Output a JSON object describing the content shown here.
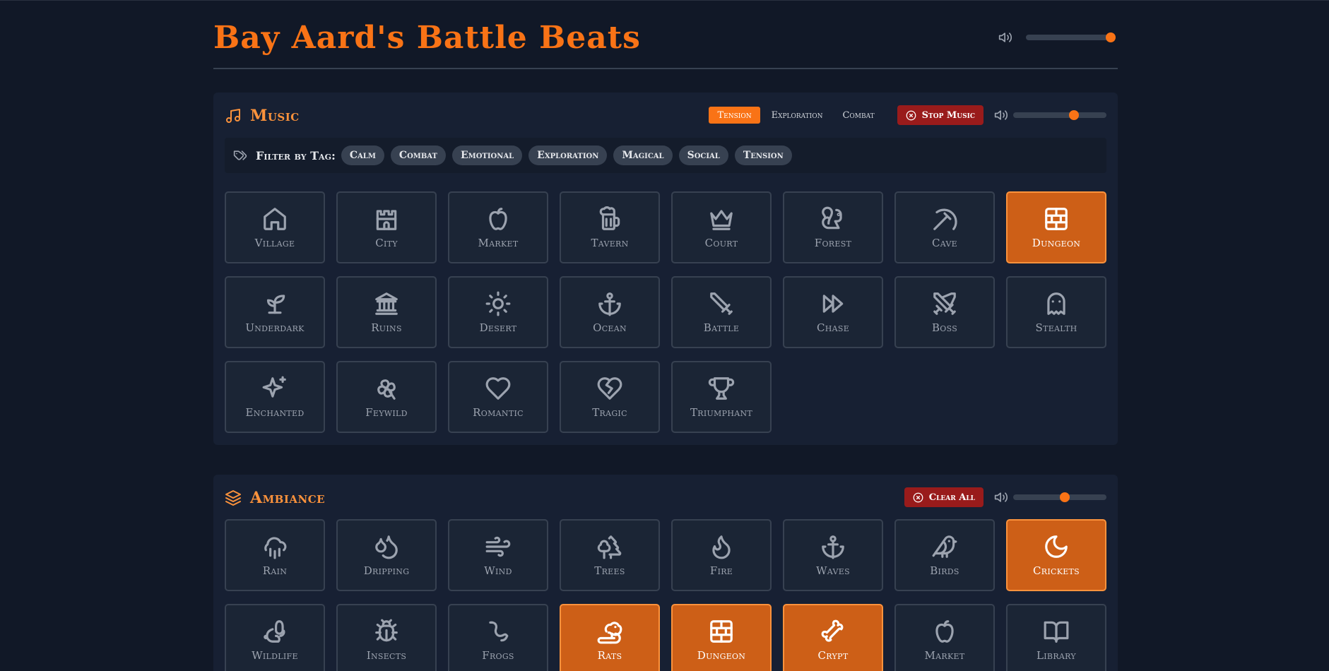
{
  "app": {
    "title": "Bay Aard's Battle Beats",
    "master_volume": 0.95
  },
  "colors": {
    "accent": "#f97316",
    "danger": "#991b1b",
    "background": "#111827"
  },
  "music": {
    "title": "Music",
    "icon": "music-note-icon",
    "modes": [
      {
        "label": "Tension",
        "active": true
      },
      {
        "label": "Exploration",
        "active": false
      },
      {
        "label": "Combat",
        "active": false
      }
    ],
    "stop_label": "Stop Music",
    "volume": 0.65,
    "filter_label": "Filter by Tag:",
    "tags": [
      "Calm",
      "Combat",
      "Emotional",
      "Exploration",
      "Magical",
      "Social",
      "Tension"
    ],
    "tiles": [
      {
        "label": "Village",
        "icon": "home-icon",
        "active": false
      },
      {
        "label": "City",
        "icon": "castle-icon",
        "active": false
      },
      {
        "label": "Market",
        "icon": "apple-icon",
        "active": false
      },
      {
        "label": "Tavern",
        "icon": "beer-mug-icon",
        "active": false
      },
      {
        "label": "Court",
        "icon": "crown-icon",
        "active": false
      },
      {
        "label": "Forest",
        "icon": "squirrel-icon",
        "active": false
      },
      {
        "label": "Cave",
        "icon": "pickaxe-icon",
        "active": false
      },
      {
        "label": "Dungeon",
        "icon": "brick-wall-icon",
        "active": true
      },
      {
        "label": "Underdark",
        "icon": "sprout-icon",
        "active": false
      },
      {
        "label": "Ruins",
        "icon": "columns-icon",
        "active": false
      },
      {
        "label": "Desert",
        "icon": "sun-icon",
        "active": false
      },
      {
        "label": "Ocean",
        "icon": "anchor-icon",
        "active": false
      },
      {
        "label": "Battle",
        "icon": "sword-icon",
        "active": false
      },
      {
        "label": "Chase",
        "icon": "fast-forward-icon",
        "active": false
      },
      {
        "label": "Boss",
        "icon": "crossed-swords-icon",
        "active": false
      },
      {
        "label": "Stealth",
        "icon": "ghost-icon",
        "active": false
      },
      {
        "label": "Enchanted",
        "icon": "sparkles-icon",
        "active": false
      },
      {
        "label": "Feywild",
        "icon": "clover-icon",
        "active": false
      },
      {
        "label": "Romantic",
        "icon": "heart-icon",
        "active": false
      },
      {
        "label": "Tragic",
        "icon": "broken-heart-icon",
        "active": false
      },
      {
        "label": "Triumphant",
        "icon": "trophy-icon",
        "active": false
      }
    ]
  },
  "ambiance": {
    "title": "Ambiance",
    "icon": "layers-icon",
    "clear_label": "Clear All",
    "volume": 0.55,
    "tiles": [
      {
        "label": "Rain",
        "icon": "cloud-rain-icon",
        "active": false
      },
      {
        "label": "Dripping",
        "icon": "droplets-icon",
        "active": false
      },
      {
        "label": "Wind",
        "icon": "wind-icon",
        "active": false
      },
      {
        "label": "Trees",
        "icon": "trees-icon",
        "active": false
      },
      {
        "label": "Fire",
        "icon": "flame-icon",
        "active": false
      },
      {
        "label": "Waves",
        "icon": "anchor-icon",
        "active": false
      },
      {
        "label": "Birds",
        "icon": "bird-icon",
        "active": false
      },
      {
        "label": "Crickets",
        "icon": "moon-icon",
        "active": true
      },
      {
        "label": "Wildlife",
        "icon": "rabbit-icon",
        "active": false
      },
      {
        "label": "Insects",
        "icon": "bug-icon",
        "active": false
      },
      {
        "label": "Frogs",
        "icon": "worm-icon",
        "active": false
      },
      {
        "label": "Rats",
        "icon": "rat-icon",
        "active": true
      },
      {
        "label": "Dungeon",
        "icon": "brick-wall-icon",
        "active": true
      },
      {
        "label": "Crypt",
        "icon": "bone-icon",
        "active": true
      },
      {
        "label": "Market",
        "icon": "apple-icon",
        "active": false
      },
      {
        "label": "Library",
        "icon": "book-open-icon",
        "active": false
      }
    ]
  }
}
